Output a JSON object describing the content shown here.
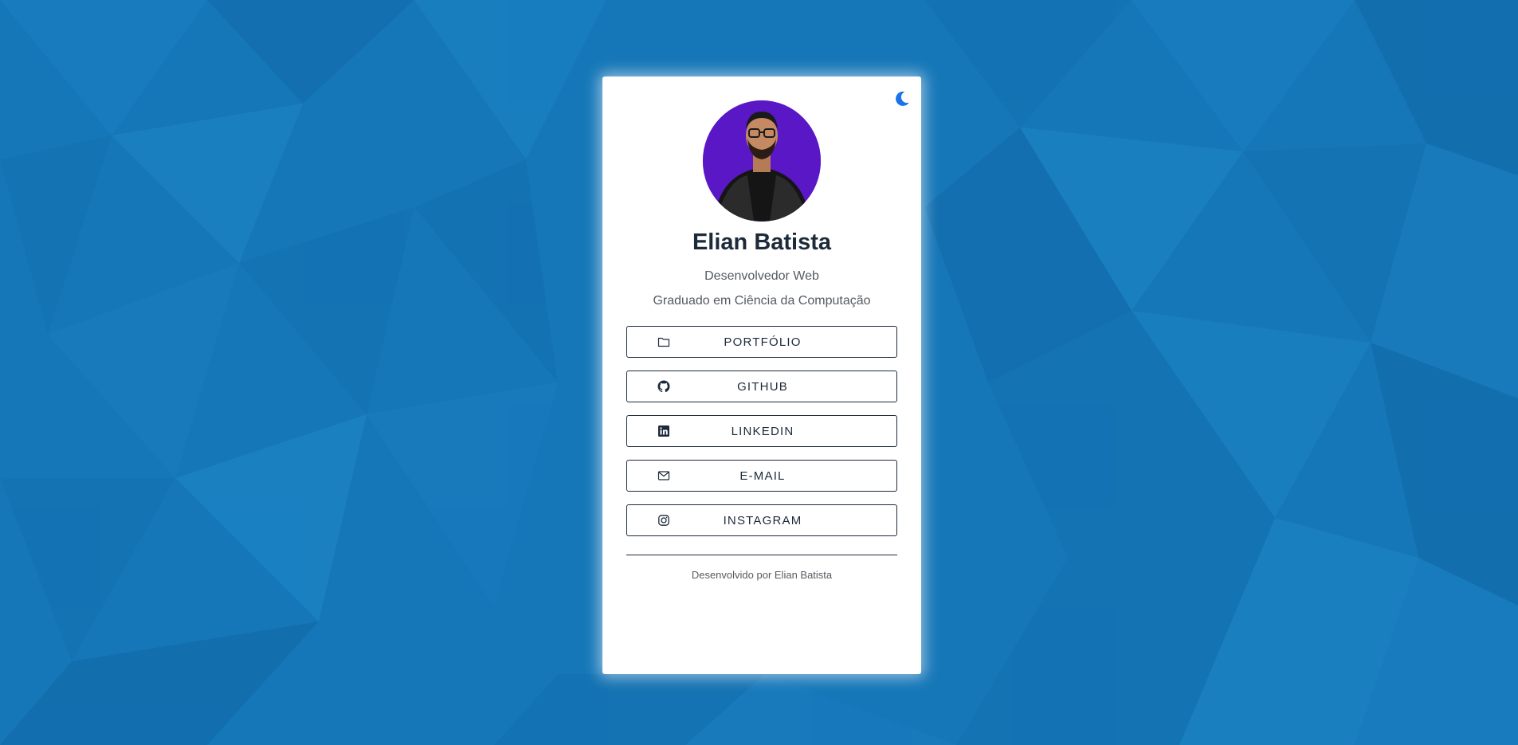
{
  "profile": {
    "name": "Elian Batista",
    "role": "Desenvolvedor Web",
    "education": "Graduado em Ciência da Computação",
    "avatar_icon": "profile-photo"
  },
  "theme_toggle": {
    "icon": "moon-icon",
    "color": "#1a73e8"
  },
  "links": [
    {
      "label": "PORTFÓLIO",
      "icon": "folder-icon"
    },
    {
      "label": "GITHUB",
      "icon": "github-icon"
    },
    {
      "label": "LINKEDIN",
      "icon": "linkedin-icon"
    },
    {
      "label": "E-MAIL",
      "icon": "envelope-icon"
    },
    {
      "label": "INSTAGRAM",
      "icon": "instagram-icon"
    }
  ],
  "footer": {
    "text": "Desenvolvido por Elian Batista"
  },
  "colors": {
    "background": "#1677b8",
    "card": "#ffffff",
    "text_dark": "#1d2a3a",
    "avatar_bg": "#5a17c6"
  }
}
